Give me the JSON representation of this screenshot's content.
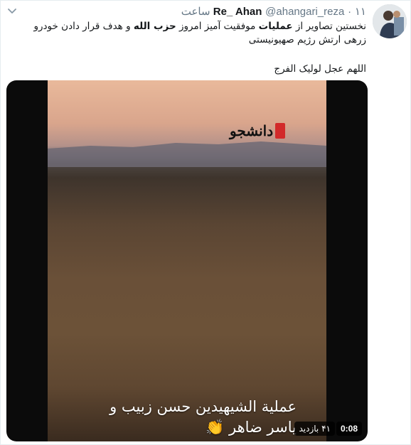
{
  "tweet": {
    "display_name": "Re_ Ahan",
    "handle": "@ahangari_reza",
    "separator": "·",
    "time": "۱۱ ساعت",
    "line1": {
      "a": "نخستین تصاویر از ",
      "b": "عملیات",
      "c": " موفقیت آمیز امروز ",
      "d": "حزب الله",
      "e": " و هدف قرار دادن خودرو"
    },
    "line2": "زرهی ارتش رژیم صهیونیستی",
    "line3": "اللهم عجل لولیک الفرج"
  },
  "media": {
    "logo_text": "دانشجو",
    "caption_line1": "عملية الشيهيدين حسن زبيب و",
    "caption_line2": "ياسر ضاهر 👏",
    "duration": "0:08",
    "views": "۴۱ بازدید"
  }
}
